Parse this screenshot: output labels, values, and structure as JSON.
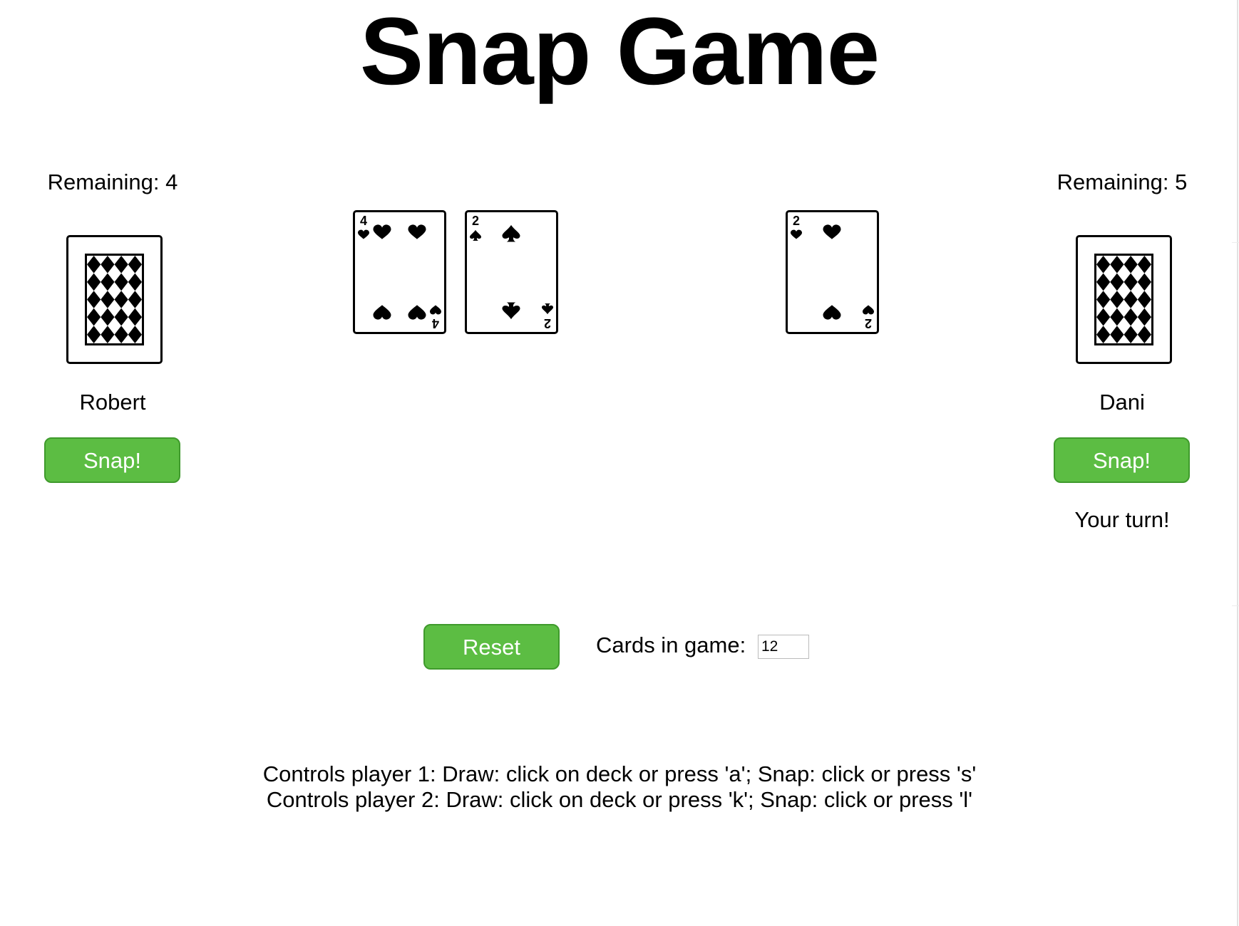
{
  "title": "Snap Game",
  "player1": {
    "remaining": "Remaining: 4",
    "name": "Robert",
    "snap_label": "Snap!",
    "turn_text": ""
  },
  "player2": {
    "remaining": "Remaining: 5",
    "name": "Dani",
    "snap_label": "Snap!",
    "turn_text": "Your turn!"
  },
  "pile": [
    {
      "rank": "4",
      "suit": "heart",
      "pips": 4
    },
    {
      "rank": "2",
      "suit": "spade",
      "pips": 2
    },
    {
      "rank": "2",
      "suit": "heart",
      "pips": 2
    }
  ],
  "colors": {
    "button_green": "#5cbd43",
    "card_ink": "#000000"
  },
  "reset_label": "Reset",
  "cards_in_game": {
    "label": "Cards in game:",
    "value": "12"
  },
  "controls": [
    "Controls player 1: Draw: click on deck or press 'a'; Snap: click or press 's'",
    "Controls player 2: Draw: click on deck or press 'k'; Snap: click or press 'l'"
  ]
}
